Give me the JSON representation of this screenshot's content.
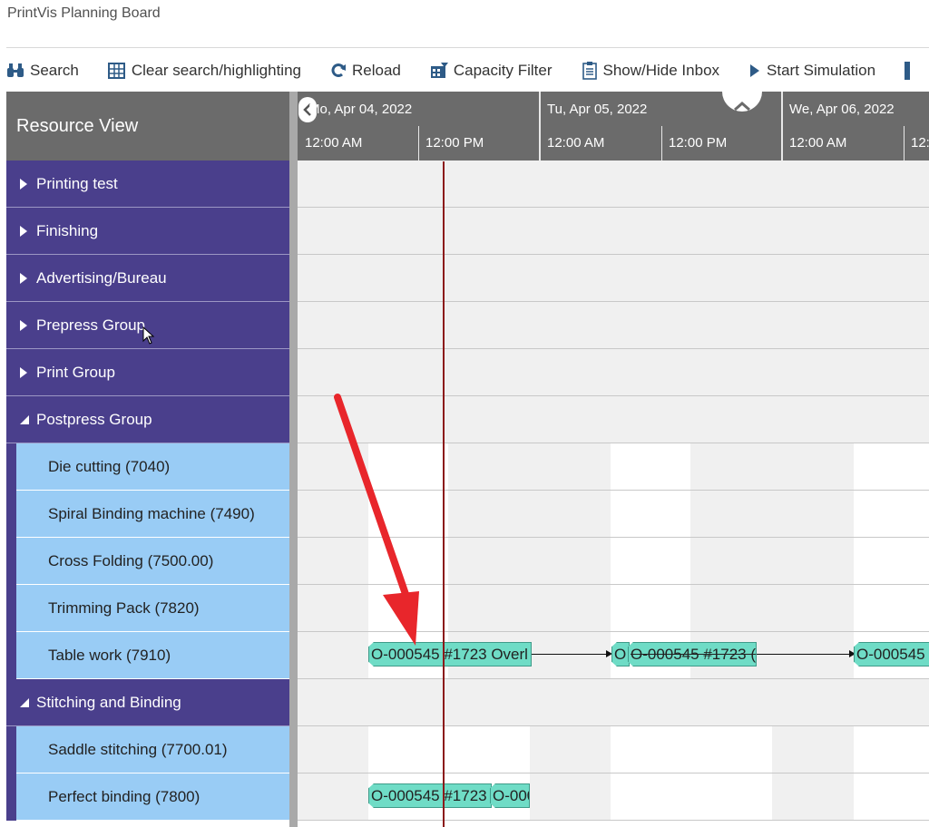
{
  "app": {
    "title": "PrintVis Planning Board"
  },
  "toolbar": {
    "buttons": [
      {
        "label": "Search",
        "icon": "binoculars-icon"
      },
      {
        "label": "Clear search/highlighting",
        "icon": "grid-clear-icon"
      },
      {
        "label": "Reload",
        "icon": "reload-icon"
      },
      {
        "label": "Capacity Filter",
        "icon": "capacity-filter-icon"
      },
      {
        "label": "Show/Hide Inbox",
        "icon": "inbox-icon"
      },
      {
        "label": "Start Simulation",
        "icon": "play-icon"
      }
    ]
  },
  "gantt": {
    "resource_header": "Resource View",
    "days": [
      "Mo, Apr 04, 2022",
      "Tu, Apr 05, 2022",
      "We, Apr 06, 2022"
    ],
    "hours": [
      "12:00 AM",
      "12:00 PM",
      "12:00 AM",
      "12:00 PM",
      "12:00 AM",
      "12:"
    ],
    "groups": [
      {
        "label": "Printing test",
        "expanded": false
      },
      {
        "label": "Finishing",
        "expanded": false
      },
      {
        "label": "Advertising/Bureau",
        "expanded": false
      },
      {
        "label": "Prepress Group",
        "expanded": false
      },
      {
        "label": "Print Group",
        "expanded": false
      },
      {
        "label": "Postpress Group",
        "expanded": true
      },
      {
        "label": "Stitching and Binding",
        "expanded": true
      }
    ],
    "resources": {
      "die_cutting": "Die cutting (7040)",
      "spiral": "Spiral Binding machine (7490)",
      "cross_folding": "Cross Folding (7500.00)",
      "trimming": "Trimming Pack (7820)",
      "table_work": "Table work (7910)",
      "saddle": "Saddle stitching (7700.01)",
      "perfect": "Perfect binding (7800)"
    },
    "tasks": {
      "tw1": "O-000545 #1723 Overl",
      "tw2": "O",
      "tw3": "O-000545 #1723 (",
      "tw4": "O-000545",
      "pb1": "O-000545 #1723",
      "pb2": "O-000"
    }
  },
  "colors": {
    "group_bg": "#4a3f8c",
    "resource_bg": "#99ccf5",
    "task_bg": "#6fdcc6",
    "header_bg": "#6b6b6b",
    "now_line": "#8b1a1a",
    "annotation_arrow": "#e8262b"
  }
}
